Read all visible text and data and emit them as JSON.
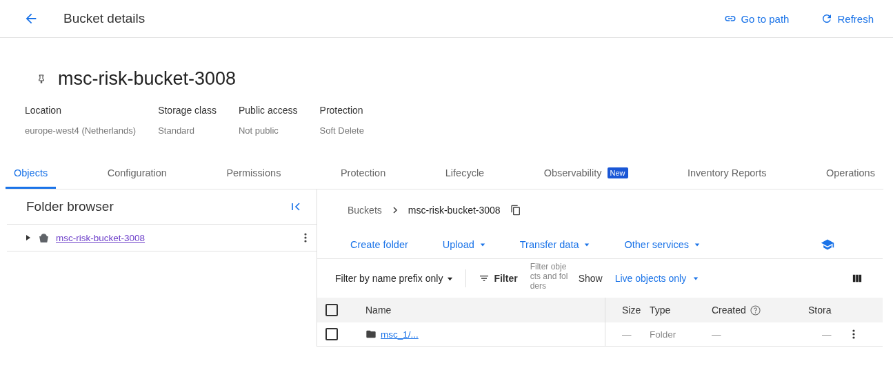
{
  "header": {
    "title": "Bucket details",
    "actions": [
      {
        "kind": "link",
        "label": "Go to path"
      },
      {
        "kind": "refresh",
        "label": "Refresh"
      }
    ]
  },
  "bucket": {
    "name": "msc-risk-bucket-3008"
  },
  "meta": [
    {
      "label": "Location",
      "value": "europe-west4 (Netherlands)"
    },
    {
      "label": "Storage class",
      "value": "Standard"
    },
    {
      "label": "Public access",
      "value": "Not public"
    },
    {
      "label": "Protection",
      "value": "Soft Delete"
    }
  ],
  "tabs": [
    {
      "label": "Objects",
      "selected": true
    },
    {
      "label": "Configuration",
      "selected": false
    },
    {
      "label": "Permissions",
      "selected": false
    },
    {
      "label": "Protection",
      "selected": false
    },
    {
      "label": "Lifecycle",
      "selected": false
    },
    {
      "label": "Observability",
      "selected": false,
      "badge": "New"
    },
    {
      "label": "Inventory Reports",
      "selected": false
    },
    {
      "label": "Operations",
      "selected": false
    }
  ],
  "folder_browser": {
    "title": "Folder browser",
    "items": [
      {
        "label": "msc-risk-bucket-3008",
        "expanded": false
      }
    ]
  },
  "breadcrumb": [
    "Buckets",
    "msc-risk-bucket-3008"
  ],
  "toolbar": [
    {
      "label": "Create folder",
      "dropdown": false
    },
    {
      "label": "Upload",
      "dropdown": true
    },
    {
      "label": "Transfer data",
      "dropdown": true
    },
    {
      "label": "Other services",
      "dropdown": true
    }
  ],
  "filter": {
    "mode": "Filter by name prefix only",
    "button": "Filter",
    "placeholder": "Filter objects and folders",
    "show_label": "Show",
    "show_value": "Live objects only"
  },
  "table": {
    "all_checked": false,
    "columns": [
      "Name",
      "Size",
      "Type",
      "Created",
      "Stora"
    ],
    "rows": [
      {
        "checked": false,
        "name": "msc_1/...",
        "size": "—",
        "type": "Folder",
        "created": "—",
        "storage": "—"
      }
    ]
  }
}
